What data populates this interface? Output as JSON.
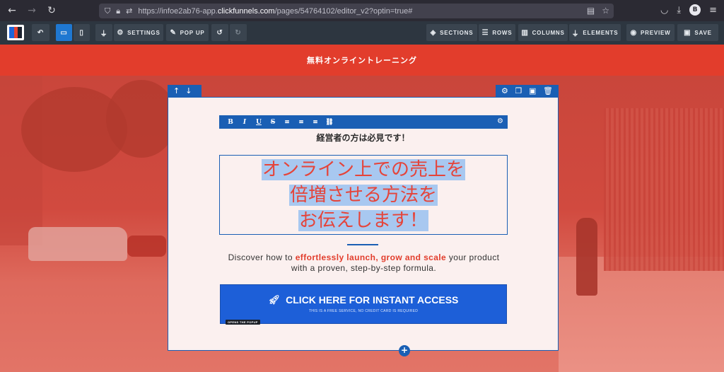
{
  "browser": {
    "url_prefix": "https://infoe2ab76-app.",
    "url_domain": "clickfunnels.com",
    "url_suffix": "/pages/54764102/editor_v2?optin=true#",
    "avatar_letter": "B"
  },
  "toolbar": {
    "settings_label": "SETTINGS",
    "popup_label": "POP UP",
    "sections_label": "SECTIONS",
    "rows_label": "ROWS",
    "columns_label": "COLUMNS",
    "elements_label": "ELEMENTS",
    "preview_label": "PREVIEW",
    "save_label": "SAVE"
  },
  "page": {
    "headline_bar": "無料オンライントレーニング",
    "sub_headline": "経営者の方は必見です！",
    "big_headline_lines": [
      "オンライン上での売上を",
      "倍増させる方法を",
      "お伝えします！"
    ],
    "desc_part1": "Discover how to ",
    "desc_emphasis": "effortlessly launch, grow and scale",
    "desc_part2": " your product",
    "desc_line2": "with a proven, step-by-step formula.",
    "cta_label": "CLICK HERE FOR INSTANT ACCESS",
    "cta_subtext": "THIS IS A FREE SERVICE, NO CREDIT CARD IS REQUIRED",
    "cta_tag": "OPENS THE POPUP"
  },
  "colors": {
    "accent_red": "#e23d2c",
    "editor_blue": "#1a5fb4",
    "cta_blue": "#1d5fd8"
  }
}
